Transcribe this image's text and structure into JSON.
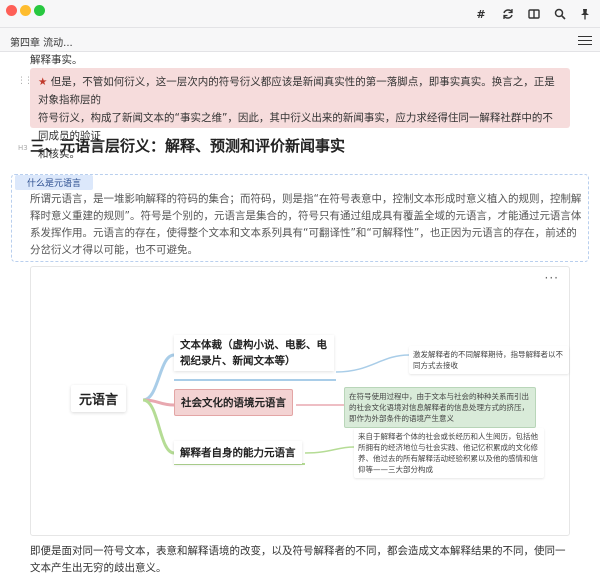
{
  "window": {
    "toolbar_icons": [
      "hash-icon",
      "sync-icon",
      "layout-icon",
      "search-icon",
      "pin-icon"
    ]
  },
  "breadcrumb": {
    "label": "第四章 流动..."
  },
  "document": {
    "top_line": "解释事实。",
    "callout": {
      "text_line1": "但是，不管如何衍义，这一层次内的符号衍义都应该是新闻真实性的第一落脚点，即事实真实。换言之，正是对象指称层的",
      "text_line2": "符号衍义，构成了新闻文本的“事实之维”，因此，其中衍义出来的新闻事实，应力求经得住同一解释社群中的不同成员的验证",
      "text_line3": "和核实。"
    },
    "heading_marker": "H3",
    "heading": "三、元语言层衍义：解释、预测和评价新闻事实",
    "concept": {
      "tag": "什么是元语言",
      "text": "所谓元语言，是一堆影响解释的符码的集合；而符码，则是指“在符号表意中，控制文本形成时意义植入的规则，控制解释时意义重建的规则”。符号是个别的，元语言是集合的，符号只有通过组成具有覆盖全域的元语言，才能通过元语言体系发挥作用。元语言的存在，使得整个文本和文本系列具有“可翻译性”和“可解释性”，也正因为元语言的存在，前述的分岔衍义才得以可能，也不可避免。"
    },
    "mindmap": {
      "more": "···",
      "root": "元语言",
      "branches": [
        {
          "label": "文本体裁（虚构小说、电影、电视纪录片、新闻文本等）",
          "leaf": "激发解释者的不同解释期待，指导解释者以不同方式去接收"
        },
        {
          "label": "社会文化的语境元语言",
          "leaf": "在符号使用过程中，由于文本与社会的种种关系而引出的社会文化语境对信息解释者的信息处理方式的挤压，即作为外部条件的语境产生意义"
        },
        {
          "label": "解释者自身的能力元语言",
          "leaf": "来自于解释者个体的社会或长经历和人生阅历，包括他所拥有的经济地位与社会实践、他记忆积累成的文化修养、他过去的所有解释活动经验积累以及他的感情和信仰等——三大部分构成"
        }
      ],
      "colors": {
        "branch1": "#a9cde8",
        "branch2": "#e8a8b0",
        "branch3": "#b5dc95"
      }
    },
    "bottom_text": "即便是面对同一符号文本，表意和解释语境的改变，以及符号解释者的不同，都会造成文本解释结果的不同，使同一文本产生出无穷的歧出意义。"
  }
}
